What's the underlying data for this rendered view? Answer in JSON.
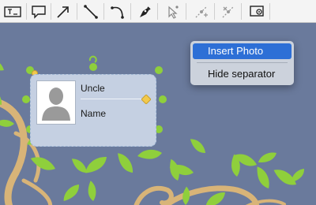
{
  "toolbar": {
    "tools": [
      {
        "name": "text-box-tool",
        "icon": "text-box-icon"
      },
      {
        "name": "callout-tool",
        "icon": "speech-bubble-icon"
      },
      {
        "name": "arrow-tool",
        "icon": "arrow-icon"
      },
      {
        "name": "line-tool",
        "icon": "line-icon"
      },
      {
        "name": "curve-tool",
        "icon": "curve-icon"
      },
      {
        "name": "pen-tool",
        "icon": "pen-nib-icon"
      },
      {
        "name": "select-point-tool",
        "icon": "cursor-point-icon"
      },
      {
        "name": "add-point-tool",
        "icon": "add-point-icon"
      },
      {
        "name": "delete-point-tool",
        "icon": "delete-point-icon"
      },
      {
        "name": "image-tool",
        "icon": "image-frame-icon"
      }
    ]
  },
  "card": {
    "relation": "Uncle",
    "name": "Name"
  },
  "context_menu": {
    "items": [
      {
        "label": "Insert Photo",
        "active": true
      },
      {
        "label": "Hide separator",
        "active": false
      }
    ]
  },
  "colors": {
    "canvas_bg": "#6a7a9c",
    "leaf": "#8fcf3c",
    "branch": "#d8b478",
    "menu_highlight": "#2d6fd6",
    "card_bg": "#c5d0e2"
  }
}
